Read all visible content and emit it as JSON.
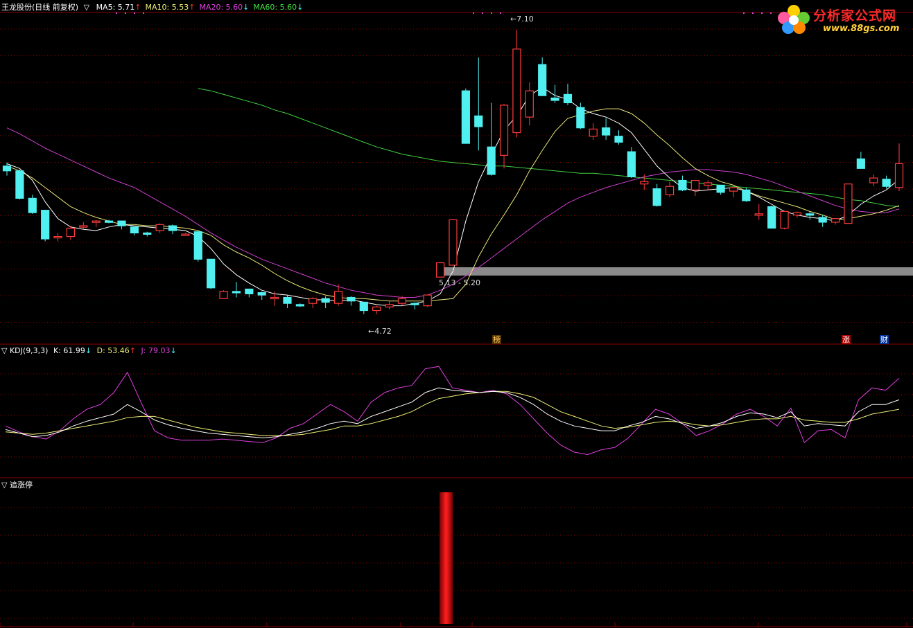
{
  "header": {
    "stock_title": "王龙股份(日线 前复权)",
    "ma_items": [
      {
        "label": "MA5: 5.71",
        "trend": "↑",
        "color": "#ffffff",
        "trend_color": "#ff3030"
      },
      {
        "label": "MA10: 5.53",
        "trend": "↑",
        "color": "#f0f078",
        "trend_color": "#ff3030"
      },
      {
        "label": "MA20: 5.60",
        "trend": "↓",
        "color": "#e040e0",
        "trend_color": "#40ffff"
      },
      {
        "label": "MA60: 5.60",
        "trend": "↓",
        "color": "#40e040",
        "trend_color": "#40ffff"
      }
    ],
    "toggle_glyph": "▽"
  },
  "logo": {
    "title": "分析家公式网",
    "url": "www.88gs.com"
  },
  "annotations": {
    "high": "7.10",
    "low": "4.72",
    "range": "5.13 - 5.20"
  },
  "markers": [
    {
      "text": "榜",
      "color": "#ffcc66",
      "bg": "#553300"
    },
    {
      "text": "涨",
      "color": "#ffffff",
      "bg": "#aa0000"
    },
    {
      "text": "财",
      "color": "#ffffff",
      "bg": "#003399"
    }
  ],
  "kdj": {
    "title": "KDJ(9,3,3)",
    "k": "K: 61.99",
    "k_trend": "↓",
    "d": "D: 53.46",
    "d_trend": "↑",
    "j": "J: 79.03",
    "j_trend": "↓",
    "k_color": "#ffffff",
    "d_color": "#f0f078",
    "j_color": "#e040e0"
  },
  "signal": {
    "title": "追涨停"
  },
  "colors": {
    "up": "#ff3c3c",
    "down": "#50f0f0",
    "grid": "#8b0000",
    "bg": "#000000"
  },
  "chart_data": {
    "type": "candlestick",
    "candles": [
      [
        5.96,
        5.99,
        5.88,
        5.92
      ],
      [
        5.92,
        5.93,
        5.68,
        5.69
      ],
      [
        5.69,
        5.72,
        5.56,
        5.57
      ],
      [
        5.59,
        5.59,
        5.33,
        5.35
      ],
      [
        5.36,
        5.4,
        5.33,
        5.37
      ],
      [
        5.37,
        5.46,
        5.34,
        5.44
      ],
      [
        5.46,
        5.49,
        5.43,
        5.46
      ],
      [
        5.49,
        5.51,
        5.45,
        5.5
      ],
      [
        5.5,
        5.51,
        5.48,
        5.49
      ],
      [
        5.5,
        5.5,
        5.43,
        5.46
      ],
      [
        5.45,
        5.45,
        5.38,
        5.4
      ],
      [
        5.4,
        5.41,
        5.37,
        5.39
      ],
      [
        5.42,
        5.48,
        5.4,
        5.47
      ],
      [
        5.46,
        5.47,
        5.39,
        5.42
      ],
      [
        5.39,
        5.4,
        5.38,
        5.39
      ],
      [
        5.41,
        5.41,
        5.16,
        5.18
      ],
      [
        5.18,
        5.18,
        4.93,
        4.94
      ],
      [
        4.85,
        4.92,
        4.85,
        4.91
      ],
      [
        4.91,
        4.99,
        4.86,
        4.9
      ],
      [
        4.93,
        4.93,
        4.86,
        4.89
      ],
      [
        4.9,
        4.91,
        4.84,
        4.88
      ],
      [
        4.86,
        4.91,
        4.79,
        4.86
      ],
      [
        4.86,
        4.88,
        4.77,
        4.81
      ],
      [
        4.8,
        4.81,
        4.78,
        4.79
      ],
      [
        4.81,
        4.86,
        4.77,
        4.85
      ],
      [
        4.85,
        4.87,
        4.77,
        4.82
      ],
      [
        4.81,
        4.97,
        4.79,
        4.91
      ],
      [
        4.86,
        4.87,
        4.79,
        4.83
      ],
      [
        4.82,
        4.82,
        4.72,
        4.75
      ],
      [
        4.75,
        4.79,
        4.72,
        4.78
      ],
      [
        4.78,
        4.83,
        4.76,
        4.8
      ],
      [
        4.81,
        4.87,
        4.79,
        4.85
      ],
      [
        4.81,
        4.82,
        4.76,
        4.8
      ],
      [
        4.79,
        4.88,
        4.78,
        4.88
      ],
      [
        5.03,
        5.05,
        5.03,
        5.15
      ],
      [
        5.13,
        5.51,
        5.13,
        5.51
      ],
      [
        6.59,
        6.61,
        6.15,
        6.15
      ],
      [
        6.38,
        6.87,
        6.09,
        6.29
      ],
      [
        6.12,
        6.49,
        5.88,
        5.89
      ],
      [
        6.05,
        6.48,
        5.94,
        6.47
      ],
      [
        6.24,
        7.1,
        6.2,
        6.94
      ],
      [
        6.37,
        6.66,
        6.3,
        6.59
      ],
      [
        6.81,
        6.87,
        6.55,
        6.55
      ],
      [
        6.53,
        6.64,
        6.49,
        6.51
      ],
      [
        6.56,
        6.65,
        6.47,
        6.49
      ],
      [
        6.45,
        6.49,
        6.27,
        6.28
      ],
      [
        6.21,
        6.32,
        6.18,
        6.27
      ],
      [
        6.28,
        6.36,
        6.18,
        6.22
      ],
      [
        6.21,
        6.26,
        6.14,
        6.16
      ],
      [
        6.08,
        6.12,
        5.86,
        5.87
      ],
      [
        5.81,
        5.89,
        5.76,
        5.83
      ],
      [
        5.77,
        5.81,
        5.62,
        5.63
      ],
      [
        5.72,
        5.83,
        5.7,
        5.79
      ],
      [
        5.84,
        5.88,
        5.75,
        5.76
      ],
      [
        5.76,
        5.84,
        5.71,
        5.84
      ],
      [
        5.8,
        5.84,
        5.76,
        5.82
      ],
      [
        5.8,
        5.8,
        5.72,
        5.74
      ],
      [
        5.75,
        5.79,
        5.7,
        5.78
      ],
      [
        5.76,
        5.78,
        5.66,
        5.67
      ],
      [
        5.55,
        5.64,
        5.51,
        5.56
      ],
      [
        5.62,
        5.63,
        5.44,
        5.44
      ],
      [
        5.44,
        5.58,
        5.43,
        5.58
      ],
      [
        5.55,
        5.58,
        5.53,
        5.57
      ],
      [
        5.56,
        5.58,
        5.51,
        5.55
      ],
      [
        5.53,
        5.55,
        5.45,
        5.49
      ],
      [
        5.49,
        5.52,
        5.47,
        5.52
      ],
      [
        5.48,
        5.81,
        5.48,
        5.81
      ],
      [
        6.02,
        6.08,
        5.99,
        5.94
      ],
      [
        5.82,
        5.89,
        5.79,
        5.86
      ],
      [
        5.85,
        5.88,
        5.77,
        5.79
      ],
      [
        5.78,
        6.15,
        5.75,
        5.98
      ]
    ],
    "ma5": [
      5.98,
      5.94,
      5.84,
      5.66,
      5.52,
      5.45,
      5.43,
      5.42,
      5.45,
      5.47,
      5.46,
      5.45,
      5.44,
      5.43,
      5.42,
      5.37,
      5.27,
      5.14,
      5.05,
      4.98,
      4.92,
      4.89,
      4.88,
      4.86,
      4.84,
      4.84,
      4.83,
      4.84,
      4.82,
      4.8,
      4.79,
      4.79,
      4.81,
      4.83,
      4.89,
      5.08,
      5.5,
      5.83,
      6.05,
      6.26,
      6.38,
      6.55,
      6.62,
      6.55,
      6.52,
      6.44,
      6.4,
      6.37,
      6.32,
      6.24,
      6.1,
      5.96,
      5.86,
      5.78,
      5.75,
      5.76,
      5.77,
      5.78,
      5.75,
      5.7,
      5.64,
      5.58,
      5.55,
      5.53,
      5.52,
      5.5,
      5.55,
      5.64,
      5.71,
      5.76,
      5.85
    ],
    "ma10": [
      5.96,
      5.92,
      5.86,
      5.78,
      5.7,
      5.62,
      5.57,
      5.53,
      5.5,
      5.47,
      5.47,
      5.46,
      5.46,
      5.45,
      5.44,
      5.42,
      5.38,
      5.3,
      5.24,
      5.19,
      5.13,
      5.06,
      5.0,
      4.95,
      4.91,
      4.88,
      4.86,
      4.85,
      4.85,
      4.84,
      4.83,
      4.83,
      4.83,
      4.83,
      4.84,
      4.85,
      4.97,
      5.2,
      5.39,
      5.55,
      5.72,
      5.92,
      6.09,
      6.25,
      6.36,
      6.39,
      6.42,
      6.44,
      6.44,
      6.4,
      6.32,
      6.22,
      6.13,
      6.03,
      5.94,
      5.88,
      5.83,
      5.8,
      5.75,
      5.71,
      5.68,
      5.65,
      5.62,
      5.58,
      5.55,
      5.51,
      5.52,
      5.54,
      5.56,
      5.59,
      5.63
    ],
    "ma20": [
      6.28,
      6.23,
      6.17,
      6.11,
      6.06,
      6.01,
      5.96,
      5.91,
      5.86,
      5.82,
      5.78,
      5.72,
      5.66,
      5.6,
      5.54,
      5.47,
      5.4,
      5.34,
      5.28,
      5.23,
      5.18,
      5.14,
      5.1,
      5.06,
      5.02,
      4.98,
      4.95,
      4.92,
      4.9,
      4.88,
      4.87,
      4.86,
      4.86,
      4.88,
      4.92,
      4.97,
      5.04,
      5.11,
      5.19,
      5.27,
      5.35,
      5.43,
      5.51,
      5.58,
      5.65,
      5.7,
      5.74,
      5.78,
      5.81,
      5.84,
      5.87,
      5.89,
      5.91,
      5.92,
      5.93,
      5.93,
      5.92,
      5.91,
      5.89,
      5.86,
      5.83,
      5.79,
      5.75,
      5.71,
      5.67,
      5.63,
      5.6,
      5.58,
      5.57,
      5.57,
      5.6
    ],
    "ma60_start_index": 15,
    "ma60": [
      6.61,
      6.59,
      6.56,
      6.53,
      6.5,
      6.47,
      6.43,
      6.4,
      6.36,
      6.32,
      6.28,
      6.24,
      6.2,
      6.16,
      6.12,
      6.09,
      6.06,
      6.04,
      6.02,
      6.0,
      5.99,
      5.98,
      5.97,
      5.96,
      5.96,
      5.95,
      5.94,
      5.93,
      5.92,
      5.91,
      5.9,
      5.9,
      5.89,
      5.88,
      5.87,
      5.86,
      5.85,
      5.84,
      5.83,
      5.82,
      5.81,
      5.8,
      5.79,
      5.78,
      5.77,
      5.76,
      5.75,
      5.74,
      5.73,
      5.72,
      5.7,
      5.68,
      5.67,
      5.65,
      5.63,
      5.62
    ],
    "kdj_k": [
      37,
      34,
      31,
      32,
      35,
      40,
      44,
      47,
      50,
      58,
      52,
      45,
      41,
      38,
      36,
      34,
      33,
      32,
      31,
      30,
      31,
      33,
      35,
      38,
      42,
      44,
      42,
      48,
      52,
      56,
      60,
      68,
      72,
      70,
      69,
      68,
      69,
      68,
      64,
      58,
      50,
      44,
      40,
      38,
      36,
      36,
      40,
      43,
      48,
      46,
      42,
      38,
      40,
      43,
      48,
      51,
      50,
      47,
      52,
      40,
      42,
      41,
      40,
      52,
      58,
      58,
      62
    ],
    "kdj_d": [
      35,
      34,
      33,
      34,
      36,
      38,
      40,
      42,
      44,
      47,
      48,
      48,
      45,
      42,
      39,
      37,
      35,
      34,
      33,
      32,
      32,
      32,
      33,
      35,
      37,
      40,
      40,
      42,
      45,
      48,
      52,
      58,
      63,
      65,
      67,
      68,
      69,
      69,
      67,
      64,
      58,
      52,
      48,
      44,
      40,
      38,
      39,
      41,
      43,
      44,
      43,
      41,
      40,
      41,
      43,
      45,
      46,
      46,
      48,
      45,
      44,
      43,
      43,
      46,
      50,
      52,
      54
    ],
    "kdj_j": [
      40,
      35,
      31,
      29,
      36,
      46,
      54,
      58,
      68,
      85,
      60,
      36,
      30,
      28,
      28,
      28,
      29,
      28,
      27,
      26,
      30,
      38,
      42,
      50,
      58,
      52,
      44,
      60,
      68,
      72,
      74,
      88,
      90,
      72,
      70,
      68,
      70,
      67,
      58,
      46,
      34,
      24,
      18,
      16,
      20,
      22,
      30,
      42,
      54,
      50,
      42,
      32,
      36,
      42,
      50,
      54,
      48,
      40,
      55,
      26,
      36,
      37,
      30,
      62,
      72,
      70,
      80
    ]
  }
}
